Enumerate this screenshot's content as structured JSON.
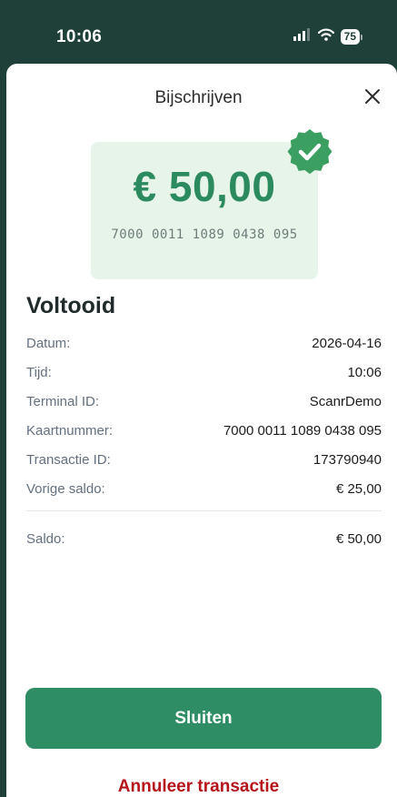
{
  "status_bar": {
    "time": "10:06",
    "battery_level": "75",
    "icons": [
      "signal-icon",
      "wifi-icon",
      "battery-icon"
    ]
  },
  "sheet": {
    "title": "Bijschrijven",
    "close_icon": "close-icon"
  },
  "amount_card": {
    "amount": "€ 50,00",
    "card_number": "7000 0011 1089 0438 095",
    "badge_icon": "verified-check-icon"
  },
  "status_heading": "Voltooid",
  "details": [
    {
      "label": "Datum:",
      "value": "2026-04-16"
    },
    {
      "label": "Tijd:",
      "value": "10:06"
    },
    {
      "label": "Terminal ID:",
      "value": "ScanrDemo"
    },
    {
      "label": "Kaartnummer:",
      "value": "7000 0011 1089 0438 095"
    },
    {
      "label": "Transactie ID:",
      "value": "173790940"
    },
    {
      "label": "Vorige saldo:",
      "value": "€ 25,00"
    }
  ],
  "saldo": {
    "label": "Saldo:",
    "value": "€ 50,00"
  },
  "actions": {
    "close_label": "Sluiten",
    "cancel_label": "Annuleer transactie"
  },
  "colors": {
    "status_bar_bg": "#1f3f39",
    "accent_green": "#2e8d64",
    "card_bg": "#e6f4ea",
    "amount_green": "#2b8a5e",
    "cancel_red": "#b5141a"
  }
}
